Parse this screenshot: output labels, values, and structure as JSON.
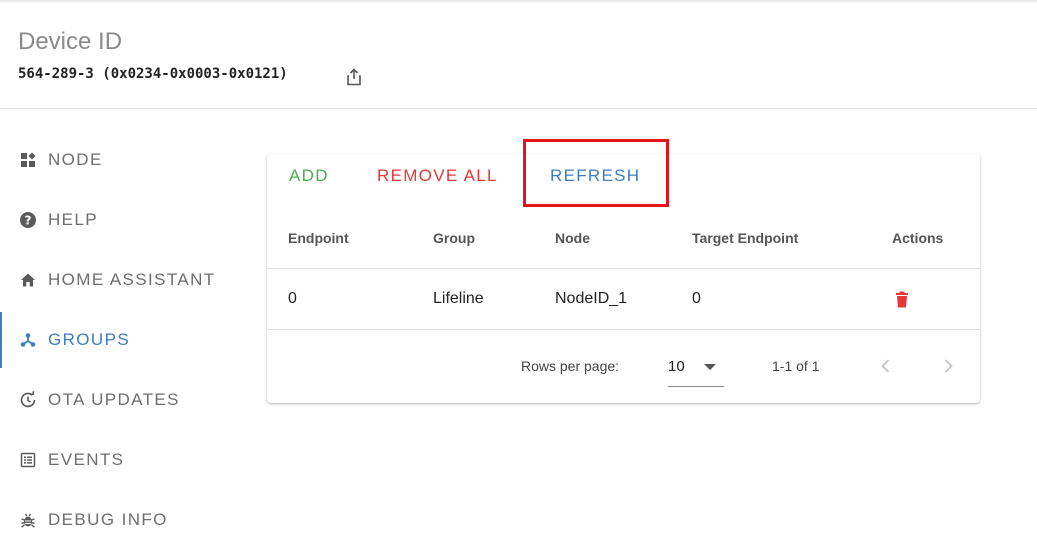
{
  "header": {
    "title": "Device ID",
    "device_id": "564-289-3 (0x0234-0x0003-0x0121)"
  },
  "nav": {
    "items": [
      {
        "label": "NODE",
        "icon": "widgets-icon"
      },
      {
        "label": "HELP",
        "icon": "help-icon"
      },
      {
        "label": "HOME ASSISTANT",
        "icon": "home-icon"
      },
      {
        "label": "GROUPS",
        "icon": "device-hub-icon",
        "active": true
      },
      {
        "label": "OTA UPDATES",
        "icon": "update-icon"
      },
      {
        "label": "EVENTS",
        "icon": "list-icon"
      },
      {
        "label": "DEBUG INFO",
        "icon": "bug-icon"
      }
    ]
  },
  "toolbar": {
    "add_label": "ADD",
    "remove_all_label": "REMOVE ALL",
    "refresh_label": "REFRESH"
  },
  "table": {
    "headers": [
      "Endpoint",
      "Group",
      "Node",
      "Target Endpoint",
      "Actions"
    ],
    "rows": [
      {
        "endpoint": "0",
        "group": "Lifeline",
        "node": "NodeID_1",
        "target_endpoint": "0"
      }
    ]
  },
  "pagination": {
    "rows_per_page_label": "Rows per page:",
    "rows_per_page_value": "10",
    "range_label": "1-1 of 1"
  },
  "colors": {
    "add": "#4caf50",
    "remove_all": "#e53935",
    "refresh": "#3b7dc4",
    "highlight_box": "#e3141e",
    "active_nav": "#3b7dc4"
  }
}
